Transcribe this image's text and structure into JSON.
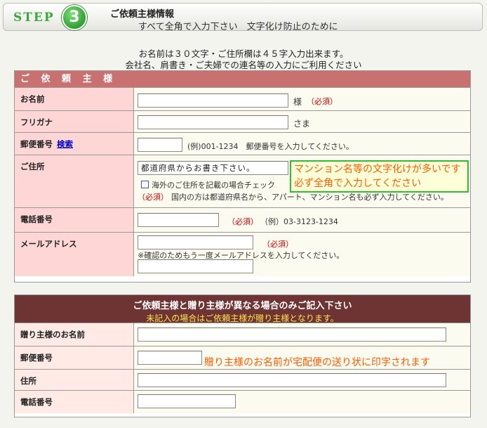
{
  "header": {
    "step_label": "STEP",
    "step_number": "3",
    "title": "ご依頼主様情報",
    "subtitle": "すべて全角で入力下さい　文字化け防止のために"
  },
  "intro": {
    "line1": "お名前は３０文字・ご住所欄は４５字入力出来ます。",
    "line2": "会社名、肩書き・ご夫婦での連名等の入力にご利用ください"
  },
  "requester": {
    "section_title": "ご 依 頼 主 様",
    "name": {
      "label": "お名前",
      "value": "",
      "suffix": "様",
      "required": "（必須）"
    },
    "kana": {
      "label": "フリガナ",
      "value": "",
      "suffix": "さま"
    },
    "postal": {
      "label": "郵便番号",
      "search_link": "検索",
      "value": "",
      "example": "(例)001-1234　郵便番号を入力してください。"
    },
    "address": {
      "label": "ご住所",
      "value": "都道府県からお書き下さい。",
      "overseas_checkbox_label": "海外のご住所を記載の場合チェック",
      "overseas_checked": false,
      "required": "（必須）",
      "note": "国内の方は都道府県名から、アパート、マンション名も必ず入力してください。"
    },
    "phone": {
      "label": "電話番号",
      "value": "",
      "required": "（必須）",
      "example": "（例）03-3123-1234"
    },
    "email": {
      "label": "メールアドレス",
      "value": "",
      "required": "（必須）",
      "confirm_note": "※確認のためもう一度メールアドレスを入力してください。",
      "confirm_value": ""
    }
  },
  "callout_address": {
    "line1": "マンション名等の文字化けが多いです",
    "line2": "必ず全角で入力してください"
  },
  "sender": {
    "section_title": "ご依頼主様と贈り主様が異なる場合のみご記入下さい",
    "section_subtitle": "未記入の場合はご依頼主様が贈り主様となります。",
    "name": {
      "label": "贈り主様のお名前",
      "value": ""
    },
    "postal": {
      "label": "郵便番号",
      "value": ""
    },
    "address": {
      "label": "住所",
      "value": ""
    },
    "phone": {
      "label": "電話番号",
      "value": ""
    }
  },
  "callout_sender": "贈り主様のお名前が宅配便の送り状に印字されます",
  "colors": {
    "step_green": "#3aa83a",
    "section_header_rose": "#c97070",
    "section_header_maroon": "#6e3333",
    "label_pink": "#ffd6d6",
    "required_red": "#cc0000",
    "callout_orange": "#ff5a00"
  }
}
